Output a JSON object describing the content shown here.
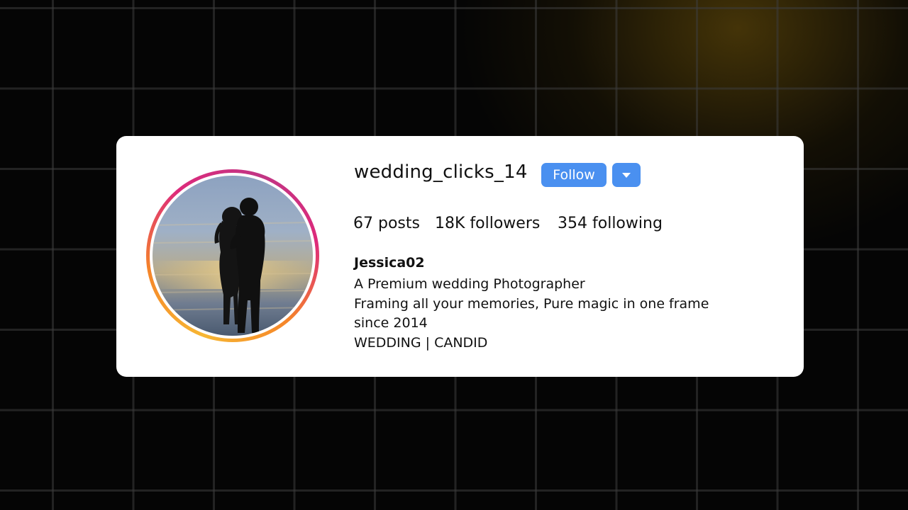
{
  "profile": {
    "username": "wedding_clicks_14",
    "follow_label": "Follow",
    "stats": {
      "posts_count": "67",
      "posts_label": "posts",
      "followers_count": "18K",
      "followers_label": "followers",
      "following_count": "354",
      "following_label": "following"
    },
    "display_name": "Jessica02",
    "bio_lines": [
      "A Premium wedding Photographer",
      "Framing all your memories, Pure magic in one frame",
      "since 2014",
      "WEDDING | CANDID"
    ]
  },
  "icons": {
    "dropdown": "chevron-down-icon",
    "avatar_ring": "story-ring"
  },
  "colors": {
    "follow_button": "#4a90f0",
    "card_background": "#ffffff",
    "page_background": "#050505",
    "ring_gradient": [
      "#f7b733",
      "#f58529",
      "#dd2a7b",
      "#c13584"
    ]
  }
}
